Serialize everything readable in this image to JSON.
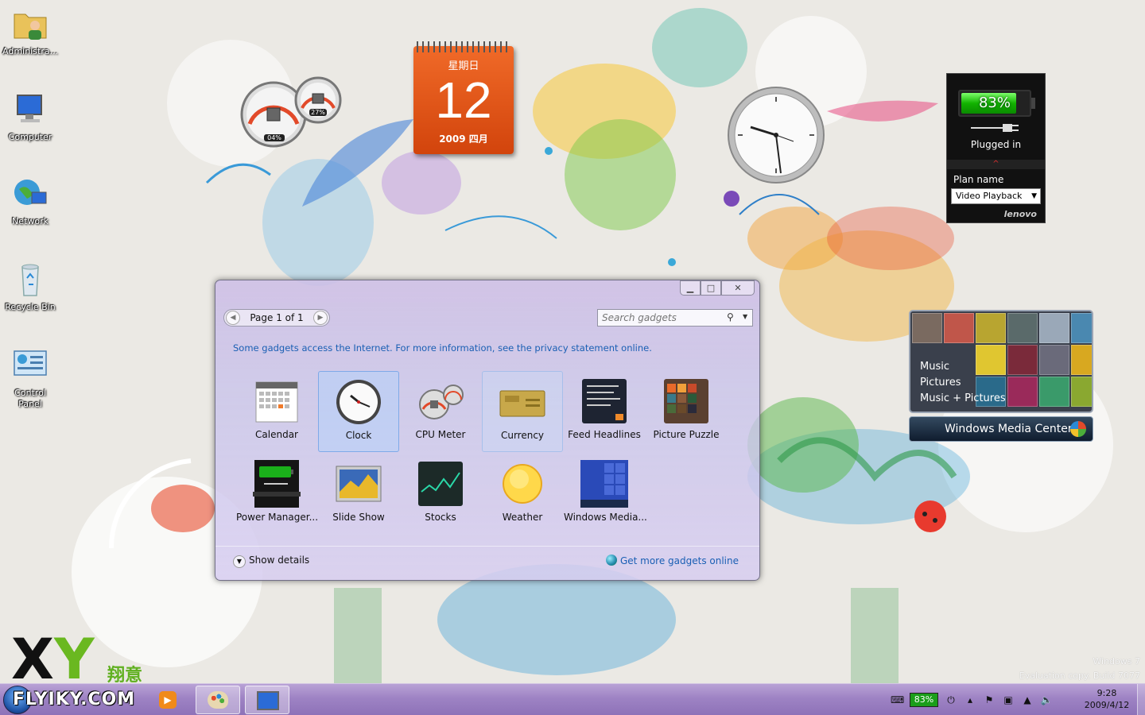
{
  "desktop_icons": [
    {
      "label": "Administra..."
    },
    {
      "label": "Computer"
    },
    {
      "label": "Network"
    },
    {
      "label": "Recycle Bin"
    },
    {
      "label": "Control Panel"
    }
  ],
  "cpu_gadget": {
    "cpu_pct": "04%",
    "mem_pct": "27%"
  },
  "calendar_gadget": {
    "weekday": "星期日",
    "day": "12",
    "year_month": "2009 四月"
  },
  "power_gadget": {
    "battery_pct": "83%",
    "battery_level": 0.83,
    "status": "Plugged in",
    "plan_label": "Plan name",
    "plan_value": "Video Playback",
    "brand": "lenovo"
  },
  "media_center": {
    "menu": [
      "Music",
      "Pictures",
      "Music + Pictures"
    ],
    "title": "Windows Media Center"
  },
  "gallery": {
    "pager": "Page 1 of 1",
    "search_placeholder": "Search gadgets",
    "notice": "Some gadgets access the Internet.  For more information, see the privacy statement online.",
    "gadgets": [
      {
        "label": "Calendar"
      },
      {
        "label": "Clock"
      },
      {
        "label": "CPU Meter"
      },
      {
        "label": "Currency"
      },
      {
        "label": "Feed Headlines"
      },
      {
        "label": "Picture Puzzle"
      },
      {
        "label": "Power Manager..."
      },
      {
        "label": "Slide Show"
      },
      {
        "label": "Stocks"
      },
      {
        "label": "Weather"
      },
      {
        "label": "Windows Media..."
      }
    ],
    "show_details": "Show details",
    "get_more": "Get more gadgets online"
  },
  "watermark": {
    "line1": "Windows 7",
    "line2": "Evaluation copy. Build 7077"
  },
  "logo": {
    "letters": "XY",
    "chinese": "翔意",
    "site": "FLYIKY.COM"
  },
  "taskbar": {
    "battery_badge": "83%",
    "time": "9:28",
    "date": "2009/4/12"
  },
  "colors": {
    "calendar_orange": "#e8561a",
    "taskbar_purple": "#9e83c4",
    "link_blue": "#1a5fb4",
    "battery_green": "#12b300"
  }
}
